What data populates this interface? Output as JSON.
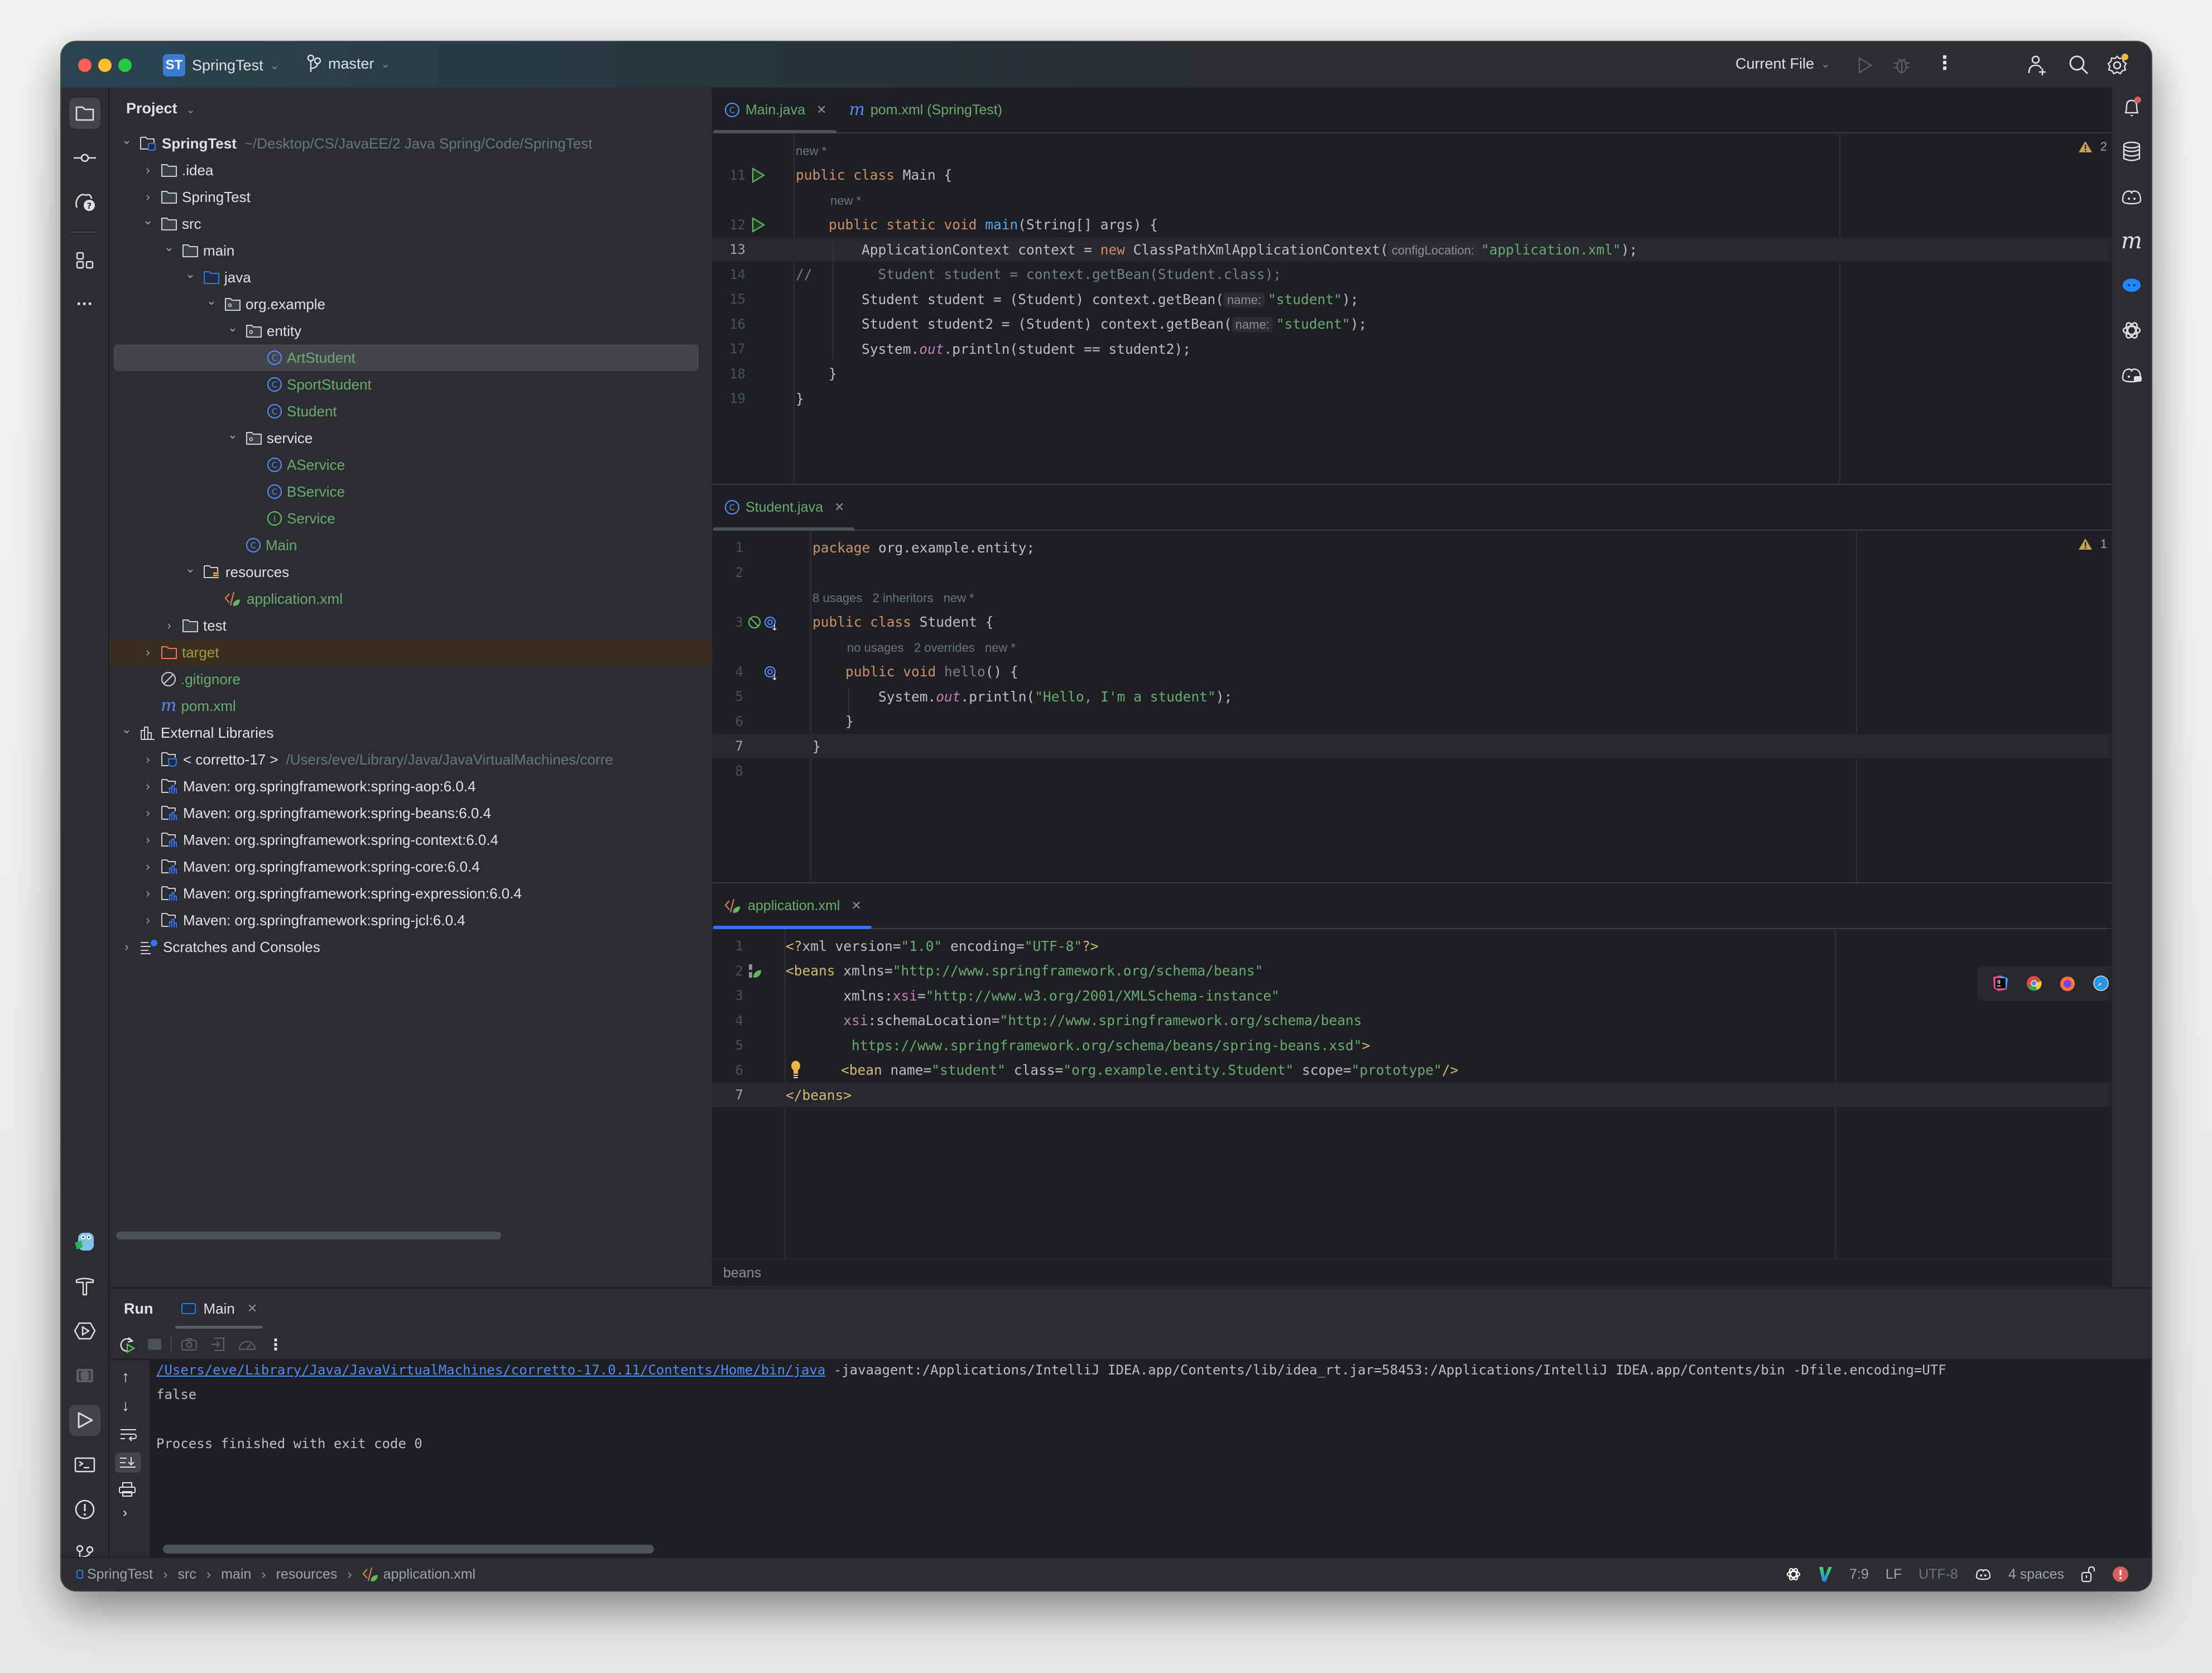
{
  "titlebar": {
    "project_badge": "ST",
    "project_name": "SpringTest",
    "branch": "master",
    "run_config": "Current File"
  },
  "project_panel": {
    "title": "Project",
    "tree": [
      {
        "label": "SpringTest",
        "hint": "~/Desktop/CS/JavaEE/2 Java Spring/Code/SpringTest",
        "depth": 0,
        "chevron": "down",
        "icon": "module-folder",
        "bold": true
      },
      {
        "label": ".idea",
        "depth": 1,
        "chevron": "right",
        "icon": "folder"
      },
      {
        "label": "SpringTest",
        "depth": 1,
        "chevron": "right",
        "icon": "folder"
      },
      {
        "label": "src",
        "depth": 1,
        "chevron": "down",
        "icon": "folder"
      },
      {
        "label": "main",
        "depth": 2,
        "chevron": "down",
        "icon": "folder"
      },
      {
        "label": "java",
        "depth": 3,
        "chevron": "down",
        "icon": "source-folder"
      },
      {
        "label": "org.example",
        "depth": 4,
        "chevron": "down",
        "icon": "package"
      },
      {
        "label": "entity",
        "depth": 5,
        "chevron": "down",
        "icon": "package"
      },
      {
        "label": "ArtStudent",
        "depth": 6,
        "icon": "class",
        "green": true,
        "selected": true
      },
      {
        "label": "SportStudent",
        "depth": 6,
        "icon": "class",
        "green": true
      },
      {
        "label": "Student",
        "depth": 6,
        "icon": "class",
        "green": true
      },
      {
        "label": "service",
        "depth": 5,
        "chevron": "down",
        "icon": "package"
      },
      {
        "label": "AService",
        "depth": 6,
        "icon": "class",
        "green": true
      },
      {
        "label": "BService",
        "depth": 6,
        "icon": "class",
        "green": true
      },
      {
        "label": "Service",
        "depth": 6,
        "icon": "interface",
        "green": true
      },
      {
        "label": "Main",
        "depth": 5,
        "icon": "class",
        "green": true
      },
      {
        "label": "resources",
        "depth": 3,
        "chevron": "down",
        "icon": "resources-folder"
      },
      {
        "label": "application.xml",
        "depth": 4,
        "icon": "spring-xml",
        "green": true
      },
      {
        "label": "test",
        "depth": 2,
        "chevron": "right",
        "icon": "folder"
      },
      {
        "label": "target",
        "depth": 1,
        "chevron": "right",
        "icon": "excluded-folder",
        "excluded": true
      },
      {
        "label": ".gitignore",
        "depth": 1,
        "icon": "ignore",
        "green": true
      },
      {
        "label": "pom.xml",
        "depth": 1,
        "icon": "maven",
        "green": true
      },
      {
        "label": "External Libraries",
        "depth": 0,
        "chevron": "down",
        "icon": "library"
      },
      {
        "label": "< corretto-17 >",
        "hint": "/Users/eve/Library/Java/JavaVirtualMachines/corre",
        "depth": 1,
        "chevron": "right",
        "icon": "jdk"
      },
      {
        "label": "Maven: org.springframework:spring-aop:6.0.4",
        "depth": 1,
        "chevron": "right",
        "icon": "lib-folder"
      },
      {
        "label": "Maven: org.springframework:spring-beans:6.0.4",
        "depth": 1,
        "chevron": "right",
        "icon": "lib-folder"
      },
      {
        "label": "Maven: org.springframework:spring-context:6.0.4",
        "depth": 1,
        "chevron": "right",
        "icon": "lib-folder"
      },
      {
        "label": "Maven: org.springframework:spring-core:6.0.4",
        "depth": 1,
        "chevron": "right",
        "icon": "lib-folder"
      },
      {
        "label": "Maven: org.springframework:spring-expression:6.0.4",
        "depth": 1,
        "chevron": "right",
        "icon": "lib-folder"
      },
      {
        "label": "Maven: org.springframework:spring-jcl:6.0.4",
        "depth": 1,
        "chevron": "right",
        "icon": "lib-folder"
      },
      {
        "label": "Scratches and Consoles",
        "depth": 0,
        "chevron": "right",
        "icon": "scratches"
      }
    ]
  },
  "editor_main": {
    "tabs": [
      {
        "label": "Main.java",
        "icon": "class",
        "closable": true,
        "active": true
      },
      {
        "label": "pom.xml (SpringTest)",
        "icon": "maven"
      }
    ],
    "warnings": "2",
    "lines": [
      {
        "lens": "new *"
      },
      {
        "n": "11",
        "run": true,
        "segs": [
          [
            "kw",
            "public class "
          ],
          [
            "",
            "Main {"
          ]
        ]
      },
      {
        "lens": "new *",
        "indent": 1
      },
      {
        "n": "12",
        "run": true,
        "segs": [
          [
            "",
            "    "
          ],
          [
            "kw",
            "public static void "
          ],
          [
            "fn",
            "main"
          ],
          [
            "",
            "(String[] args) {"
          ]
        ]
      },
      {
        "n": "13",
        "current": true,
        "segs": [
          [
            "",
            "        ApplicationContext context = "
          ],
          [
            "kw",
            "new "
          ],
          [
            "",
            "ClassPathXmlApplicationContext("
          ],
          [
            "inlay",
            "configLocation:"
          ],
          [
            "str",
            "\"application.xml\""
          ],
          [
            "",
            ");"
          ]
        ]
      },
      {
        "n": "14",
        "segs": [
          [
            "cmt",
            "//        Student student = context.getBean(Student.class);"
          ]
        ]
      },
      {
        "n": "15",
        "segs": [
          [
            "",
            "        Student student = (Student) context.getBean("
          ],
          [
            "inlay",
            "name:"
          ],
          [
            "str",
            "\"student\""
          ],
          [
            "",
            ");"
          ]
        ]
      },
      {
        "n": "16",
        "segs": [
          [
            "",
            "        Student student2 = (Student) context.getBean("
          ],
          [
            "inlay",
            "name:"
          ],
          [
            "str",
            "\"student\""
          ],
          [
            "",
            ");"
          ]
        ]
      },
      {
        "n": "17",
        "segs": [
          [
            "",
            "        System."
          ],
          [
            "field",
            "out"
          ],
          [
            "",
            ".println(student == student2);"
          ]
        ]
      },
      {
        "n": "18",
        "segs": [
          [
            "",
            "    }"
          ]
        ]
      },
      {
        "n": "19",
        "segs": [
          [
            "",
            "}"
          ]
        ]
      }
    ]
  },
  "editor_student": {
    "tabs": [
      {
        "label": "Student.java",
        "icon": "class",
        "closable": true,
        "active": true
      }
    ],
    "warnings": "1",
    "lines": [
      {
        "n": "1",
        "segs": [
          [
            "kw",
            "package "
          ],
          [
            "",
            "org.example.entity;"
          ]
        ]
      },
      {
        "n": "2",
        "segs": []
      },
      {
        "lens": "8 usages   2 inheritors   new *"
      },
      {
        "n": "3",
        "gutter": "inheritors",
        "segs": [
          [
            "kw",
            "public class "
          ],
          [
            "",
            "Student {"
          ]
        ]
      },
      {
        "lens": "no usages   2 overrides   new *",
        "indent": 1
      },
      {
        "n": "4",
        "gutter": "overrides",
        "segs": [
          [
            "",
            "    "
          ],
          [
            "kw",
            "public void "
          ],
          [
            "cmt",
            "hello"
          ],
          [
            "",
            "() {"
          ]
        ]
      },
      {
        "n": "5",
        "segs": [
          [
            "",
            "        System."
          ],
          [
            "field",
            "out"
          ],
          [
            "",
            ".println("
          ],
          [
            "str",
            "\"Hello, I'm a student\""
          ],
          [
            "",
            ");"
          ]
        ]
      },
      {
        "n": "6",
        "segs": [
          [
            "",
            "    }"
          ]
        ]
      },
      {
        "n": "7",
        "current": true,
        "segs": [
          [
            "",
            "}"
          ]
        ]
      },
      {
        "n": "8",
        "segs": []
      }
    ]
  },
  "editor_xml": {
    "tabs": [
      {
        "label": "application.xml",
        "icon": "spring-xml",
        "closable": true,
        "active": true
      }
    ],
    "breadcrumb": "beans",
    "browser_icons": [
      "intellij-icon",
      "chrome-icon",
      "firefox-icon",
      "safari-icon"
    ],
    "lines": [
      {
        "n": "1",
        "segs": [
          [
            "tag",
            "<?"
          ],
          [
            "attr",
            "xml version="
          ],
          [
            "str",
            "\"1.0\""
          ],
          [
            "attr",
            " encoding="
          ],
          [
            "str",
            "\"UTF-8\""
          ],
          [
            "tag",
            "?>"
          ]
        ]
      },
      {
        "n": "2",
        "gutter": "spring",
        "segs": [
          [
            "tag",
            "<beans"
          ],
          [
            "attr",
            " xmlns="
          ],
          [
            "str",
            "\"http://www.springframework.org/schema/beans\""
          ]
        ]
      },
      {
        "n": "3",
        "segs": [
          [
            "attr",
            "       xmlns:"
          ],
          [
            "ns",
            "xsi"
          ],
          [
            "attr",
            "="
          ],
          [
            "str",
            "\"http://www.w3.org/2001/XMLSchema-instance\""
          ]
        ]
      },
      {
        "n": "4",
        "segs": [
          [
            "ns",
            "       xsi"
          ],
          [
            "attr",
            ":schemaLocation="
          ],
          [
            "str",
            "\"http://www.springframework.org/schema/beans"
          ]
        ]
      },
      {
        "n": "5",
        "segs": [
          [
            "str",
            "        https://www.springframework.org/schema/beans/spring-beans.xsd\""
          ],
          [
            "tag",
            ">"
          ]
        ]
      },
      {
        "n": "6",
        "bulb": true,
        "segs": [
          [
            "",
            "    "
          ],
          [
            "tag",
            "<bean"
          ],
          [
            "attr",
            " name="
          ],
          [
            "str",
            "\"student\""
          ],
          [
            "attr",
            " class="
          ],
          [
            "str",
            "\"org.example.entity.Student\""
          ],
          [
            "attr",
            " scope="
          ],
          [
            "str",
            "\"prototype\""
          ],
          [
            "tag",
            "/>"
          ]
        ]
      },
      {
        "n": "7",
        "current": true,
        "segs": [
          [
            "tag",
            "</beans>"
          ]
        ]
      }
    ]
  },
  "run_panel": {
    "title": "Run",
    "tab": "Main",
    "console": {
      "cmd_link": "/Users/eve/Library/Java/JavaVirtualMachines/corretto-17.0.11/Contents/Home/bin/java",
      "cmd_rest": " -javaagent:/Applications/IntelliJ IDEA.app/Contents/lib/idea_rt.jar=58453:/Applications/IntelliJ IDEA.app/Contents/bin -Dfile.encoding=UTF",
      "output": "false",
      "exit": "Process finished with exit code 0"
    }
  },
  "statusbar": {
    "breadcrumbs": [
      "SpringTest",
      "src",
      "main",
      "resources",
      "application.xml"
    ],
    "position": "7:9",
    "line_sep": "LF",
    "encoding": "UTF-8",
    "indent": "4 spaces"
  },
  "colors": {
    "accent": "#3574f0",
    "string": "#6aab73",
    "keyword": "#cf8e6d",
    "warning": "#e0a443",
    "error": "#db5c5c"
  }
}
